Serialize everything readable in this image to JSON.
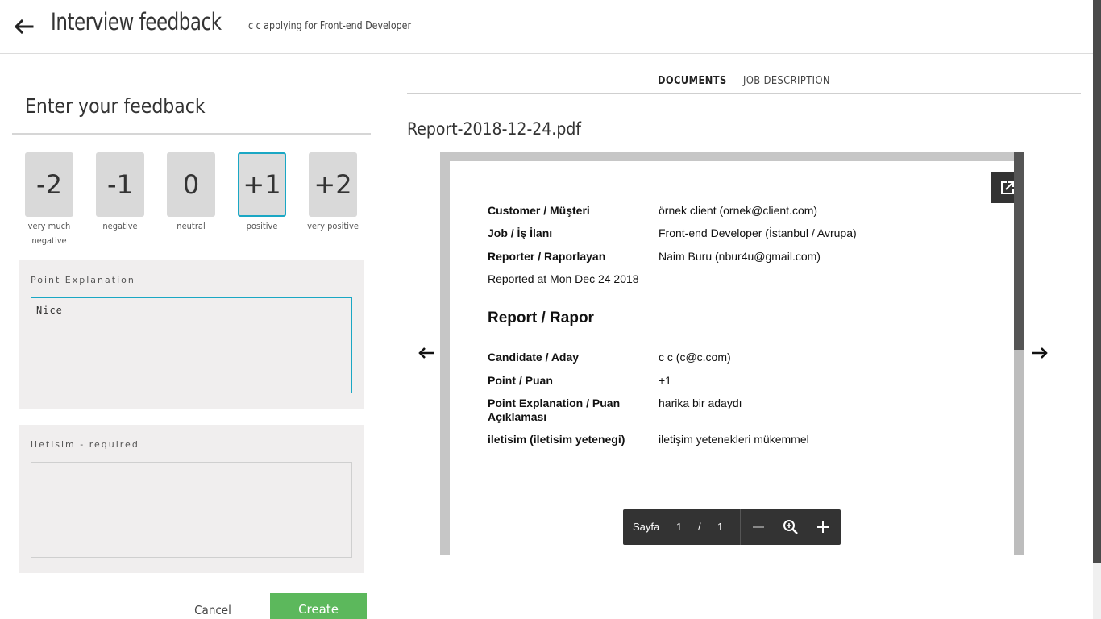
{
  "header": {
    "title": "Interview feedback",
    "subtitle": "c c applying for Front-end Developer"
  },
  "feedback": {
    "heading": "Enter your feedback",
    "scores": [
      {
        "value": "-2",
        "label": "very much negative"
      },
      {
        "value": "-1",
        "label": "negative"
      },
      {
        "value": "0",
        "label": "neutral"
      },
      {
        "value": "+1",
        "label": "positive"
      },
      {
        "value": "+2",
        "label": "very positive"
      }
    ],
    "selected_score": "+1",
    "point_explanation": {
      "label": "Point Explanation",
      "value": "Nice"
    },
    "iletisim": {
      "label": "iletisim - required",
      "value": ""
    },
    "cancel_label": "Cancel",
    "create_label": "Create"
  },
  "tabs": [
    {
      "label": "DOCUMENTS",
      "active": true
    },
    {
      "label": "JOB DESCRIPTION",
      "active": false
    }
  ],
  "document": {
    "filename": "Report-2018-12-24.pdf",
    "rows": [
      {
        "key": "Customer / Müşteri",
        "value": "örnek client (ornek@client.com)"
      },
      {
        "key": "Job / İş İlanı",
        "value": "Front-end Developer (İstanbul / Avrupa)"
      },
      {
        "key": "Reporter / Raporlayan",
        "value": "Naim Buru (nbur4u@gmail.com)"
      }
    ],
    "reported_at": "Reported at Mon Dec 24 2018",
    "report_heading": "Report / Rapor",
    "report_rows": [
      {
        "key": "Candidate / Aday",
        "value": "c c (c@c.com)"
      },
      {
        "key": "Point / Puan",
        "value": "+1"
      },
      {
        "key": "Point Explanation / Puan Açıklaması",
        "value": "harika bir adaydı"
      },
      {
        "key": "iletisim (iletisim yetenegi)",
        "value": "iletişim yetenekleri mükemmel"
      }
    ],
    "toolbar": {
      "page_label": "Sayfa",
      "current_page": "1",
      "separator": "/",
      "total_pages": "1"
    }
  },
  "colors": {
    "accent": "#1aa7c4",
    "create_button": "#5cb85c",
    "toolbar": "#333333"
  }
}
